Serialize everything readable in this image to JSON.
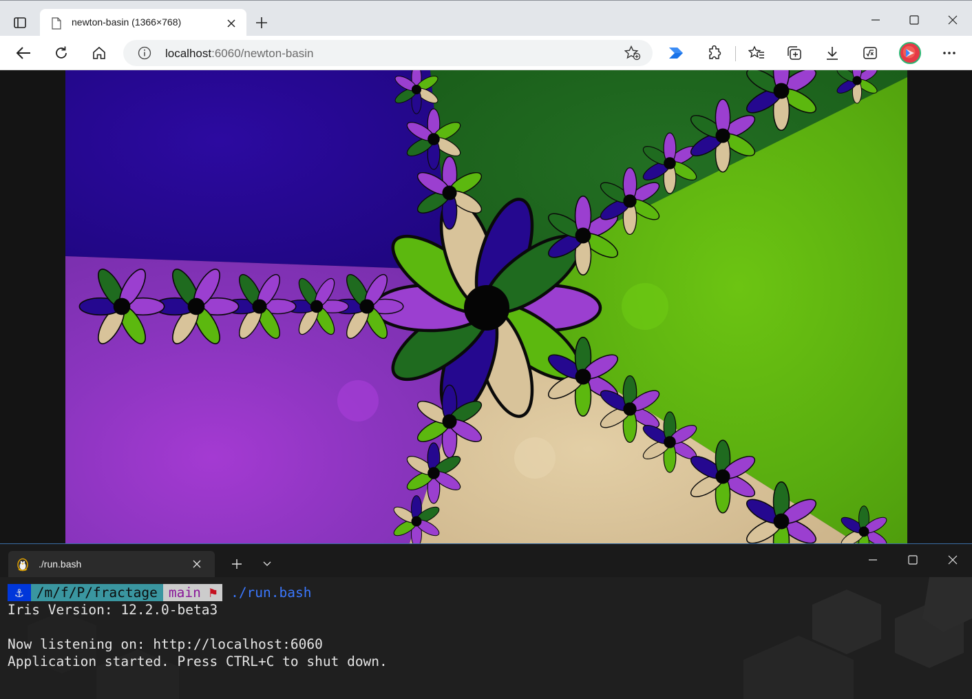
{
  "browser": {
    "tab": {
      "title": "newton-basin (1366×768)"
    },
    "address": {
      "host": "localhost",
      "rest": ":6060/newton-basin"
    },
    "icons": [
      "tab-actions-icon",
      "page-icon",
      "close-icon",
      "plus-icon",
      "minimize-icon",
      "maximize-icon",
      "back-icon",
      "refresh-icon",
      "home-icon",
      "info-icon",
      "add-favorite-icon",
      "copilot-icon",
      "extensions-icon",
      "favorites-icon",
      "collections-icon",
      "downloads-icon",
      "math-solver-icon",
      "profile-avatar",
      "more-icon"
    ]
  },
  "terminal": {
    "tab": {
      "title": "./run.bash"
    },
    "prompt": {
      "anchor": "⚓",
      "path": "/m/f/P/fractage",
      "branch": "main",
      "flag": "⚑",
      "command": "./run.bash"
    },
    "lines": [
      "Iris Version: 12.2.0-beta3",
      "",
      "Now listening on: http://localhost:6060",
      "Application started. Press CTRL+C to shut down."
    ]
  },
  "colors": {
    "purple_root": "#9b3fd0",
    "green_root": "#5cb80f",
    "tan_root": "#d8c39a",
    "indigo_root": "#25088f",
    "dark_green_root": "#1f6b1f"
  }
}
